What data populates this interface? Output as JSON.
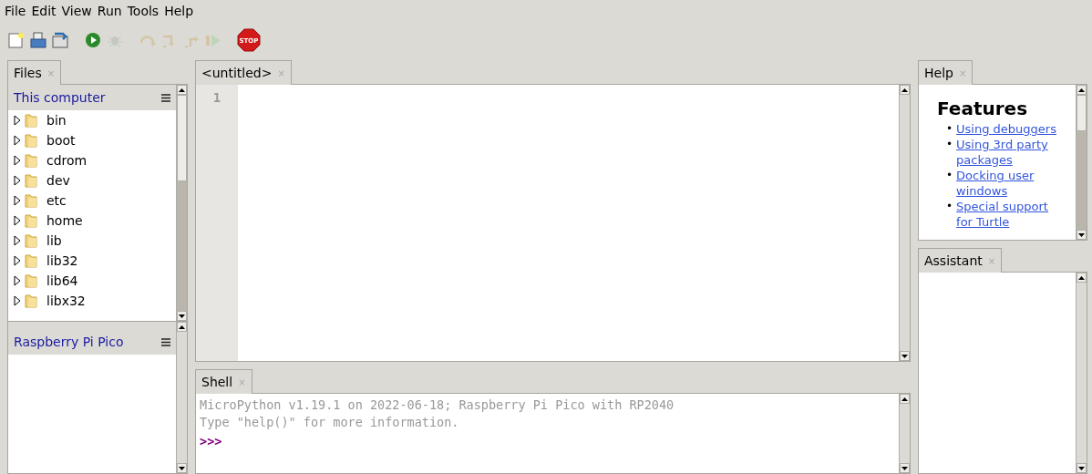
{
  "menu": [
    "File",
    "Edit",
    "View",
    "Run",
    "Tools",
    "Help"
  ],
  "toolbar": [
    {
      "kind": "new",
      "disabled": false
    },
    {
      "kind": "open",
      "disabled": false
    },
    {
      "kind": "save",
      "disabled": false
    },
    {
      "kind": "run",
      "disabled": false
    },
    {
      "kind": "debug",
      "disabled": true
    },
    {
      "kind": "step-over",
      "disabled": true
    },
    {
      "kind": "step-into",
      "disabled": true
    },
    {
      "kind": "step-out",
      "disabled": true
    },
    {
      "kind": "resume",
      "disabled": true
    },
    {
      "kind": "stop",
      "disabled": false,
      "label": "STOP"
    }
  ],
  "files": {
    "tab": {
      "label": "Files",
      "close": "×"
    },
    "this_computer": {
      "title": "This computer",
      "items": [
        "bin",
        "boot",
        "cdrom",
        "dev",
        "etc",
        "home",
        "lib",
        "lib32",
        "lib64",
        "libx32"
      ]
    },
    "device": {
      "title": "Raspberry Pi Pico"
    }
  },
  "editor": {
    "tab": {
      "label": "<untitled>",
      "close": "×"
    },
    "line_numbers": [
      "1"
    ]
  },
  "shell": {
    "tab": {
      "label": "Shell",
      "close": "×"
    },
    "lines": [
      {
        "kind": "output",
        "text": "MicroPython v1.19.1 on 2022-06-18; Raspberry Pi Pico with RP2040"
      },
      {
        "kind": "output",
        "text": "Type \"help()\" for more information."
      },
      {
        "kind": "prompt",
        "text": ">>>"
      }
    ]
  },
  "help": {
    "tab": {
      "label": "Help",
      "close": "×"
    },
    "heading": "Features",
    "links": [
      {
        "bullet": "•",
        "text": "Using debuggers"
      },
      {
        "bullet": "•",
        "text": "Using 3rd party packages"
      },
      {
        "bullet": "•",
        "text": "Docking user windows"
      },
      {
        "bullet": "•",
        "text": "Special support for Turtle"
      }
    ]
  },
  "assistant": {
    "tab": {
      "label": "Assistant",
      "close": "×"
    }
  }
}
